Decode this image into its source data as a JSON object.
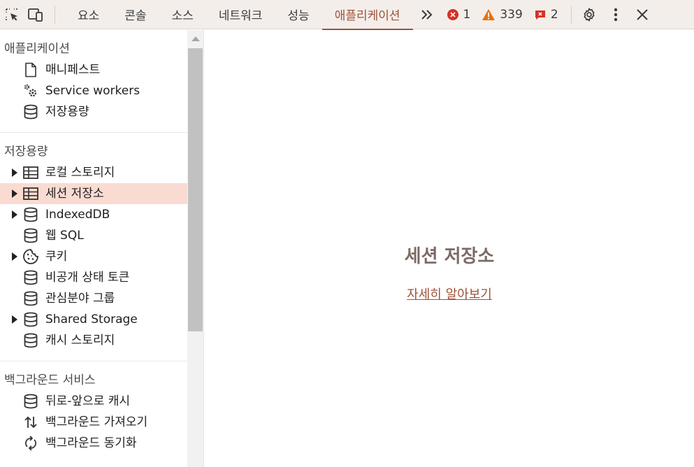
{
  "toolbar": {
    "inspect_icon": "inspect-element-icon",
    "device_icon": "device-toggle-icon",
    "tabs": [
      "요소",
      "콘솔",
      "소스",
      "네트워크",
      "성능",
      "애플리케이션"
    ],
    "active_tab": "애플리케이션",
    "more_tabs_icon": "chevron-double-right-icon",
    "errors": "1",
    "warnings": "339",
    "issues": "2",
    "settings_icon": "gear-icon",
    "menu_icon": "kebab-menu-icon",
    "close_icon": "close-icon",
    "colors": {
      "error": "#d93025",
      "warning": "#e8710a",
      "issue": "#d93025",
      "accent": "#a0523a"
    }
  },
  "sidebar": {
    "application": {
      "title": "애플리케이션",
      "items": [
        {
          "label": "매니페스트",
          "icon": "document-icon"
        },
        {
          "label": "Service workers",
          "icon": "gears-icon"
        },
        {
          "label": "저장용량",
          "icon": "database-icon"
        }
      ]
    },
    "storage": {
      "title": "저장용량",
      "items": [
        {
          "label": "로컬 스토리지",
          "icon": "table-icon",
          "expandable": true
        },
        {
          "label": "세션 저장소",
          "icon": "table-icon",
          "expandable": true,
          "selected": true
        },
        {
          "label": "IndexedDB",
          "icon": "database-icon",
          "expandable": true
        },
        {
          "label": "웹 SQL",
          "icon": "database-icon"
        },
        {
          "label": "쿠키",
          "icon": "cookie-icon",
          "expandable": true
        },
        {
          "label": "비공개 상태 토큰",
          "icon": "database-icon"
        },
        {
          "label": "관심분야 그룹",
          "icon": "database-icon"
        },
        {
          "label": "Shared Storage",
          "icon": "database-icon",
          "expandable": true
        },
        {
          "label": "캐시 스토리지",
          "icon": "database-icon"
        }
      ]
    },
    "background": {
      "title": "백그라운드 서비스",
      "items": [
        {
          "label": "뒤로-앞으로 캐시",
          "icon": "database-icon"
        },
        {
          "label": "백그라운드 가져오기",
          "icon": "arrows-up-down-icon"
        },
        {
          "label": "백그라운드 동기화",
          "icon": "sync-icon"
        }
      ]
    }
  },
  "main": {
    "title": "세션 저장소",
    "learn_more": "자세히 알아보기"
  }
}
